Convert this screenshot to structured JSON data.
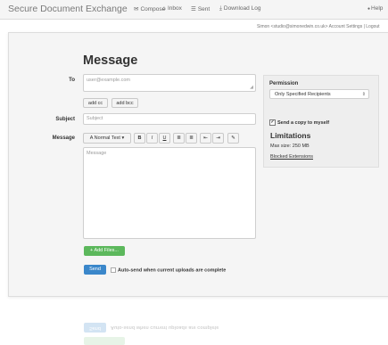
{
  "header": {
    "brand": "Secure Document Exchange",
    "nav": [
      {
        "icon": "compose-icon",
        "glyph": "✉",
        "label": "Compose"
      },
      {
        "icon": "inbox-icon",
        "glyph": "⌂",
        "label": "Inbox"
      },
      {
        "icon": "sent-icon",
        "glyph": "☰",
        "label": "Sent"
      },
      {
        "icon": "download-icon",
        "glyph": "⤓",
        "label": "Download Log"
      }
    ],
    "help_glyph": "●",
    "help_label": "Help",
    "userline": "Simon <studio@simonedwin.co.uk> Account Settings | Logout"
  },
  "form": {
    "title": "Message",
    "to_label": "To",
    "to_value": "user@example.com",
    "add_cc": "add cc",
    "add_bcc": "add bcc",
    "subject_label": "Subject",
    "subject_placeholder": "Subject",
    "message_label": "Message",
    "toolbar": {
      "format": "A Normal Text ▾",
      "bold": "B",
      "italic": "I",
      "underline": "U",
      "ul": "≣",
      "ol": "≣",
      "outdent": "⇤",
      "indent": "⇥",
      "pen": "✎"
    },
    "message_placeholder": "Message",
    "add_files": "+ Add Files...",
    "send": "Send",
    "autosend": "Auto-send when current uploads are complete"
  },
  "sidebar": {
    "permission_label": "Permission",
    "permission_value": "Only Specified Recipients",
    "copy_label": "Send a copy to myself",
    "copy_checked": "✓",
    "limitations_heading": "Limitations",
    "max_size": "Max size: 250 MB",
    "blocked": "Blocked Extensions"
  },
  "colors": {
    "send": "#3a87ca",
    "add_files": "#5cb85c",
    "panel": "#f5f5f5"
  }
}
